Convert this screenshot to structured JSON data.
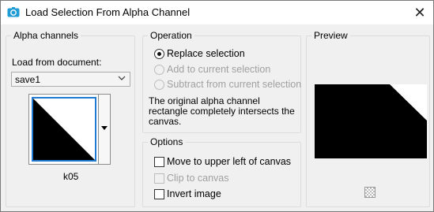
{
  "window": {
    "title": "Load Selection From Alpha Channel",
    "close_glyph": "✕"
  },
  "alpha_channels": {
    "legend": "Alpha channels",
    "load_from_label": "Load from document:",
    "document_value": "save1",
    "channel_name": "k05"
  },
  "operation": {
    "legend": "Operation",
    "options": [
      {
        "label": "Replace selection",
        "selected": true,
        "enabled": true
      },
      {
        "label": "Add to current selection",
        "selected": false,
        "enabled": false
      },
      {
        "label": "Subtract from current selection",
        "selected": false,
        "enabled": false
      }
    ],
    "note_lines": [
      "The original alpha channel",
      "rectangle completely intersects the",
      "canvas."
    ]
  },
  "options": {
    "legend": "Options",
    "items": [
      {
        "label": "Move to upper left of canvas",
        "checked": false,
        "enabled": true
      },
      {
        "label": "Clip to canvas",
        "checked": false,
        "enabled": false
      },
      {
        "label": "Invert image",
        "checked": false,
        "enabled": true
      }
    ]
  },
  "preview": {
    "legend": "Preview"
  },
  "colors": {
    "accent": "#1f7ad1",
    "disabled_text": "#a0a0a0"
  }
}
